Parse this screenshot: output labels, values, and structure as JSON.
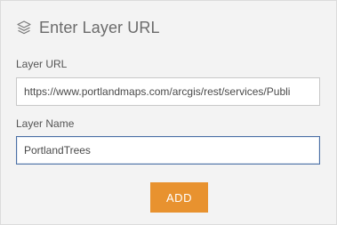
{
  "dialog": {
    "title": "Enter Layer URL",
    "title_icon": "layers-icon"
  },
  "form": {
    "url_label": "Layer URL",
    "url_value": "https://www.portlandmaps.com/arcgis/rest/services/Publi",
    "name_label": "Layer Name",
    "name_value": "PortlandTrees"
  },
  "actions": {
    "add_label": "ADD"
  },
  "colors": {
    "accent": "#e8922f",
    "focus_border": "#4a6fa5",
    "panel_bg": "#f3f3f3"
  }
}
